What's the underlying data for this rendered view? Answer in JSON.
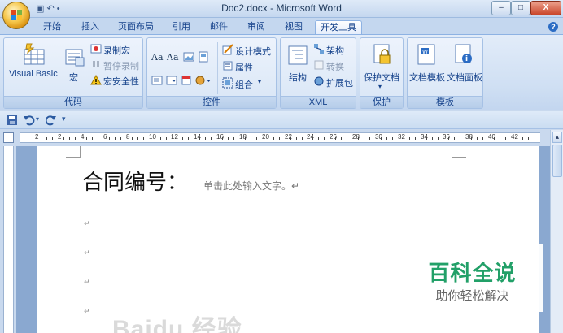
{
  "window": {
    "title": "Doc2.docx - Microsoft Word",
    "qat_mini": "▣ ↶ •",
    "minimize": "–",
    "maximize": "□",
    "close": "X"
  },
  "tabs": [
    "开始",
    "插入",
    "页面布局",
    "引用",
    "邮件",
    "审阅",
    "视图",
    "开发工具"
  ],
  "active_tab": "开发工具",
  "help": "?",
  "ribbon": {
    "code": {
      "label": "代码",
      "visual_basic": "Visual Basic",
      "macro": "宏",
      "record_macro": "录制宏",
      "pause_record": "暂停录制",
      "macro_security": "宏安全性"
    },
    "controls": {
      "label": "控件",
      "aa1": "Aa",
      "aa2": "Aa",
      "design_mode": "设计模式",
      "properties": "属性",
      "group": "组合"
    },
    "xml": {
      "label": "XML",
      "structure": "结构",
      "schema": "架构",
      "transform": "转换",
      "expansion": "扩展包"
    },
    "protect": {
      "label": "保护",
      "protect_doc": "保护文档"
    },
    "templates": {
      "label": "模板",
      "doc_template": "文档模板",
      "doc_panel": "文档面板"
    }
  },
  "ruler_numbers": [
    "2",
    "2",
    "4",
    "6",
    "8",
    "10",
    "12",
    "14",
    "16",
    "18",
    "20",
    "22",
    "24",
    "26",
    "28",
    "30",
    "32",
    "34",
    "36",
    "38",
    "40",
    "42"
  ],
  "document": {
    "title": "合同编号：",
    "placeholder": "单击此处输入文字。↵",
    "para_mark": "↵"
  },
  "watermark": {
    "title": "百科全说",
    "subtitle": "助你轻松解决",
    "baidu": "Baidu 经验"
  },
  "colors": {
    "ribbon_text": "#15428b",
    "watermark_green": "#22a068"
  }
}
